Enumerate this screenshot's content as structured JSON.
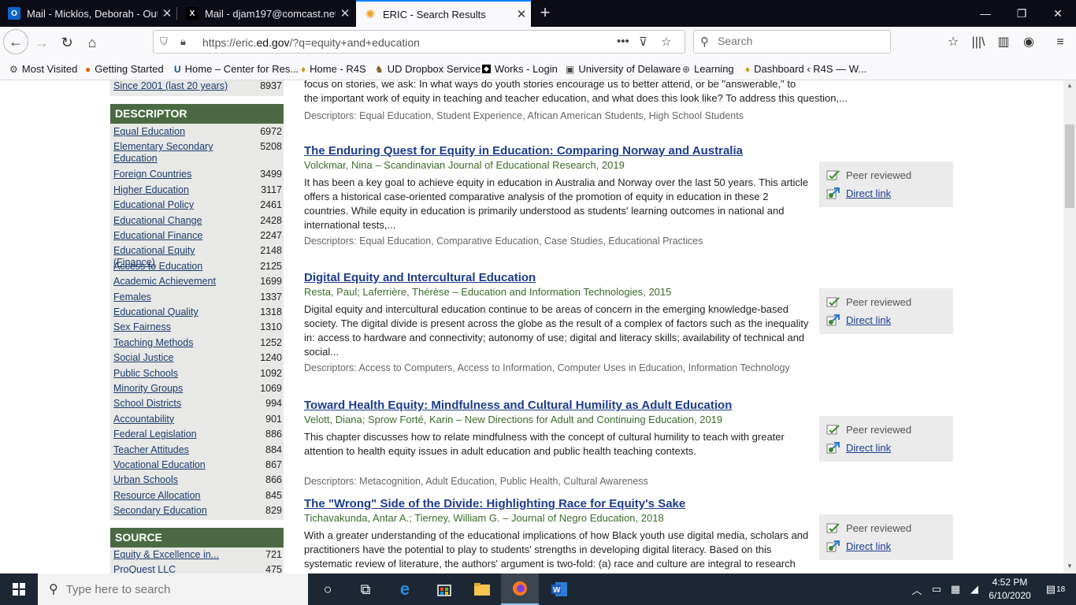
{
  "tabs": [
    {
      "title": "Mail - Micklos, Deborah - Outlo",
      "icon": "outlook-icon"
    },
    {
      "title": "Mail - djam197@comcast.net -",
      "icon": "x-mail-icon"
    },
    {
      "title": "ERIC - Search Results",
      "icon": "eric-icon",
      "active": true
    }
  ],
  "navbar": {
    "url_prefix": "https://eric.",
    "url_domain": "ed.gov",
    "url_path": "/?q=equity+and+education",
    "search_placeholder": "Search"
  },
  "bookmarks": [
    {
      "label": "Most Visited",
      "icon": "gear-icon"
    },
    {
      "label": "Getting Started",
      "icon": "firefox-icon"
    },
    {
      "label": "Home – Center for Res...",
      "icon": "ud-icon"
    },
    {
      "label": "Home - R4S",
      "icon": "r4s-icon"
    },
    {
      "label": "UD Dropbox Service",
      "icon": "dropbox-icon"
    },
    {
      "label": "Works - Login",
      "icon": "works-icon"
    },
    {
      "label": "University of Delaware",
      "icon": "ud-bus-icon"
    },
    {
      "label": "Learning",
      "icon": "globe-icon"
    },
    {
      "label": "Dashboard ‹ R4S — W...",
      "icon": "r4s-icon"
    }
  ],
  "sidebar": {
    "top_item": {
      "label": "Since 2001 (last 20 years)",
      "count": "8937"
    },
    "descriptor_heading": "DESCRIPTOR",
    "descriptors": [
      {
        "label": "Equal Education",
        "count": "6972"
      },
      {
        "label": "Elementary Secondary Education",
        "count": "5208"
      },
      {
        "label": "Foreign Countries",
        "count": "3499"
      },
      {
        "label": "Higher Education",
        "count": "3117"
      },
      {
        "label": "Educational Policy",
        "count": "2461"
      },
      {
        "label": "Educational Change",
        "count": "2428"
      },
      {
        "label": "Educational Finance",
        "count": "2247"
      },
      {
        "label": "Educational Equity (Finance)",
        "count": "2148"
      },
      {
        "label": "Access to Education",
        "count": "2125"
      },
      {
        "label": "Academic Achievement",
        "count": "1699"
      },
      {
        "label": "Females",
        "count": "1337"
      },
      {
        "label": "Educational Quality",
        "count": "1318"
      },
      {
        "label": "Sex Fairness",
        "count": "1310"
      },
      {
        "label": "Teaching Methods",
        "count": "1252"
      },
      {
        "label": "Social Justice",
        "count": "1240"
      },
      {
        "label": "Public Schools",
        "count": "1092"
      },
      {
        "label": "Minority Groups",
        "count": "1069"
      },
      {
        "label": "School Districts",
        "count": "994"
      },
      {
        "label": "Accountability",
        "count": "901"
      },
      {
        "label": "Federal Legislation",
        "count": "886"
      },
      {
        "label": "Teacher Attitudes",
        "count": "884"
      },
      {
        "label": "Vocational Education",
        "count": "867"
      },
      {
        "label": "Urban Schools",
        "count": "866"
      },
      {
        "label": "Resource Allocation",
        "count": "845"
      },
      {
        "label": "Secondary Education",
        "count": "829"
      }
    ],
    "source_heading": "SOURCE",
    "sources": [
      {
        "label": "Equity & Excellence in...",
        "count": "721"
      },
      {
        "label": "ProQuest LLC",
        "count": "475"
      }
    ]
  },
  "results": {
    "partial_top": {
      "line1": "focus on stories, we ask: In what ways do youth stories encourage us to better attend, or be \"answerable,\" to",
      "line2": "the important work of equity in teaching and teacher education, and what does this look like? To address this question,...",
      "descriptors": "Descriptors: Equal Education, Student Experience, African American Students, High School Students"
    },
    "items": [
      {
        "title": "The Enduring Quest for Equity in Education: Comparing Norway and Australia",
        "author": "Volckmar, Nina – Scandinavian Journal of Educational Research, 2019",
        "abstract": "It has been a key goal to achieve equity in education in Australia and Norway over the last 50 years. This article offers a historical case-oriented comparative analysis of the promotion of equity in education in these 2 countries. While equity in education is primarily understood as students' learning outcomes in national and international tests,...",
        "descriptors": "Descriptors: Equal Education, Comparative Education, Case Studies, Educational Practices",
        "peer_reviewed": "Peer reviewed",
        "direct_link": "Direct link"
      },
      {
        "title": "Digital Equity and Intercultural Education",
        "author": "Resta, Paul; Laferrière, Thérèse – Education and Information Technologies, 2015",
        "abstract": "Digital equity and intercultural education continue to be areas of concern in the emerging knowledge-based society. The digital divide is present across the globe as the result of a complex of factors such as the inequality in: access to hardware and connectivity; autonomy of use; digital and literacy skills; availability of technical and social...",
        "descriptors": "Descriptors: Access to Computers, Access to Information, Computer Uses in Education, Information Technology",
        "peer_reviewed": "Peer reviewed",
        "direct_link": "Direct link"
      },
      {
        "title": "Toward Health Equity: Mindfulness and Cultural Humility as Adult Education",
        "author": "Velott, Diana; Sprow Forté, Karin – New Directions for Adult and Continuing Education, 2019",
        "abstract": "This chapter discusses how to relate mindfulness with the concept of cultural humility to teach with greater attention to health equity issues in adult education and public health teaching contexts.",
        "descriptors": "Descriptors: Metacognition, Adult Education, Public Health, Cultural Awareness",
        "peer_reviewed": "Peer reviewed",
        "direct_link": "Direct link"
      },
      {
        "title": "The \"Wrong\" Side of the Divide: Highlighting Race for Equity's Sake",
        "author": "Tichavakunda, Antar A.; Tierney, William G. – Journal of Negro Education, 2018",
        "abstract": "With a greater understanding of the educational implications of how Black youth use digital media, scholars and practitioners have the potential to play to students' strengths in developing digital literacy. Based on this systematic review of literature, the authors' argument is two-fold: (a) race and culture are integral to research",
        "descriptors": "",
        "peer_reviewed": "Peer reviewed",
        "direct_link": "Direct link"
      }
    ]
  },
  "taskbar": {
    "search_placeholder": "Type here to search",
    "time": "4:52 PM",
    "date": "6/10/2020",
    "notifications": "18"
  }
}
